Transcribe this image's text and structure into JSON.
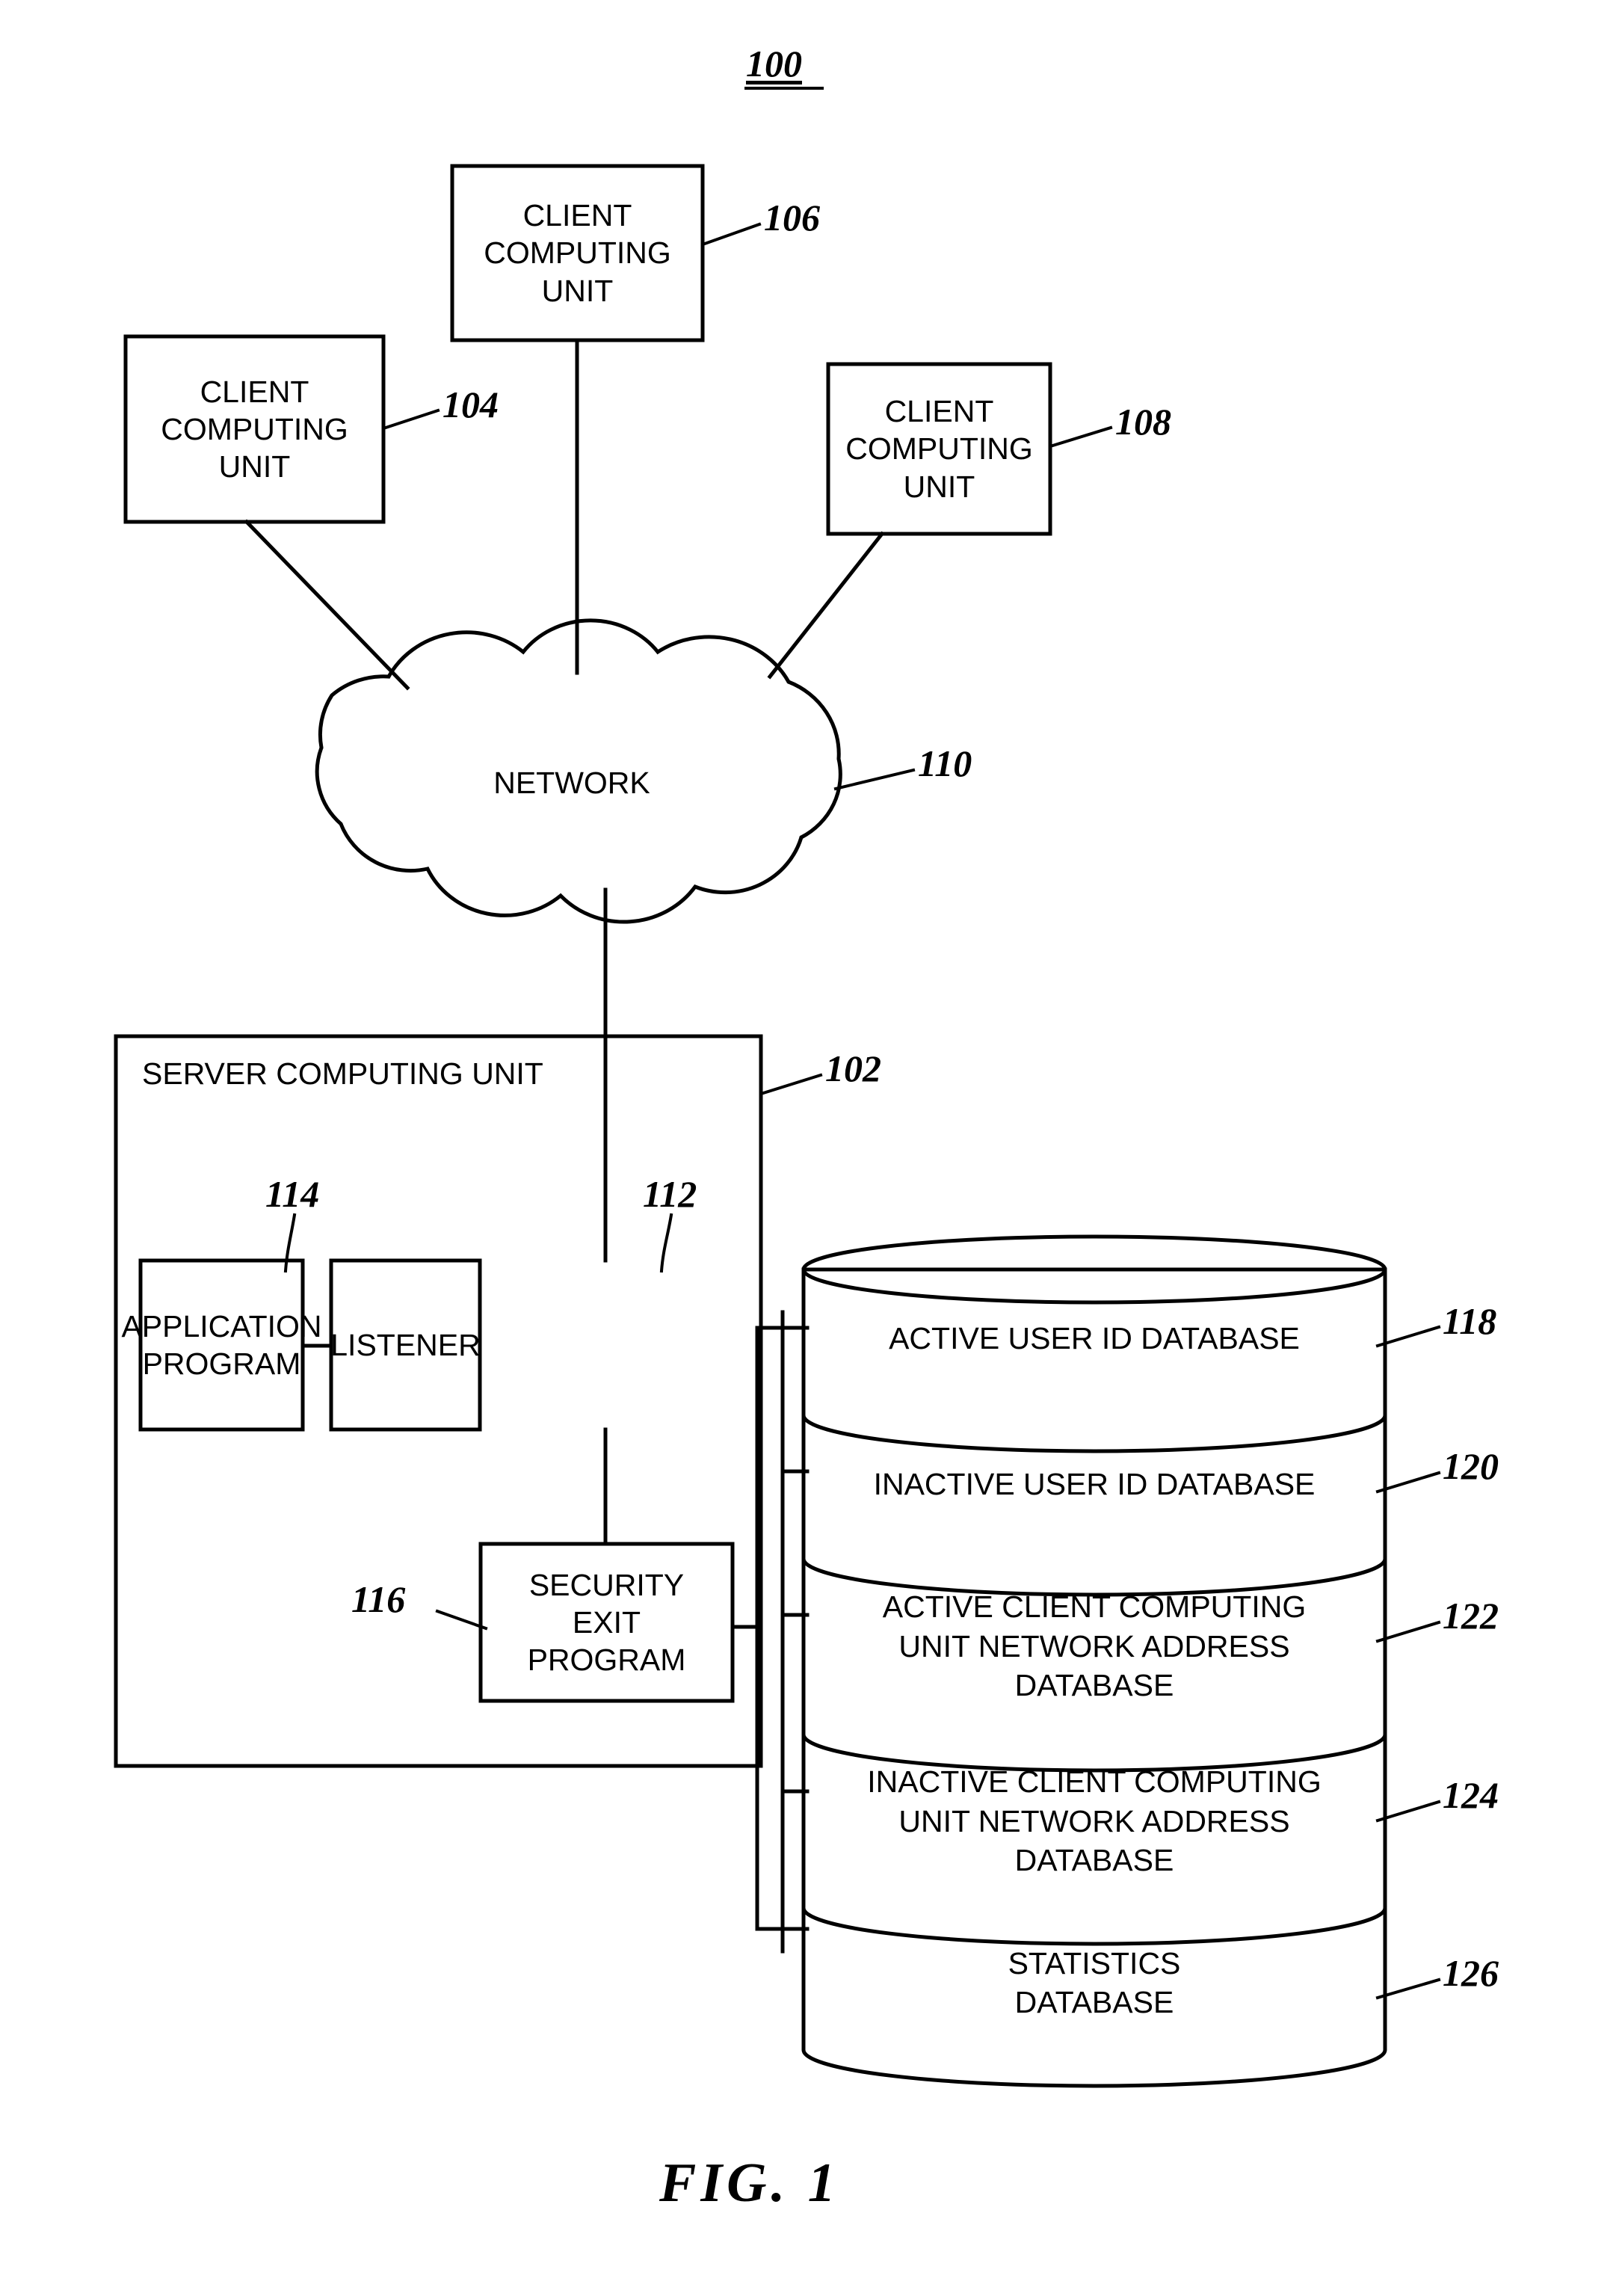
{
  "figure": {
    "system_number": "100",
    "caption": "FIG.  1"
  },
  "nodes": {
    "client_top": {
      "label": "CLIENT\nCOMPUTING\nUNIT",
      "ref": "106"
    },
    "client_left": {
      "label": "CLIENT\nCOMPUTING\nUNIT",
      "ref": "104"
    },
    "client_right": {
      "label": "CLIENT\nCOMPUTING\nUNIT",
      "ref": "108"
    },
    "network": {
      "label": "NETWORK",
      "ref": "110"
    },
    "server": {
      "label": "SERVER COMPUTING UNIT",
      "ref": "102"
    },
    "application_program": {
      "label": "APPLICATION\nPROGRAM",
      "ref": "114"
    },
    "listener": {
      "label": "LISTENER",
      "ref": "112"
    },
    "security_exit_program": {
      "label": "SECURITY\nEXIT\nPROGRAM",
      "ref": "116"
    }
  },
  "databases": [
    {
      "label": "ACTIVE USER ID DATABASE",
      "ref": "118"
    },
    {
      "label": "INACTIVE USER ID DATABASE",
      "ref": "120"
    },
    {
      "label": "ACTIVE CLIENT COMPUTING\nUNIT NETWORK ADDRESS\nDATABASE",
      "ref": "122"
    },
    {
      "label": "INACTIVE CLIENT COMPUTING\nUNIT NETWORK ADDRESS\nDATABASE",
      "ref": "124"
    },
    {
      "label": "STATISTICS\nDATABASE",
      "ref": "126"
    }
  ],
  "style": {
    "line_color": "#000000",
    "background": "#ffffff"
  }
}
